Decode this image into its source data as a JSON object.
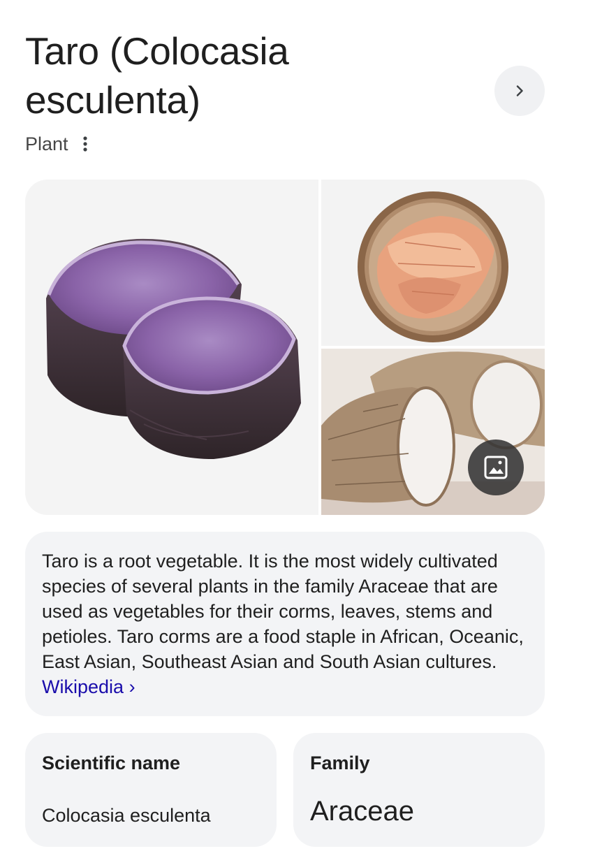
{
  "header": {
    "title": "Taro (Colocasia esculenta)",
    "subtitle": "Plant"
  },
  "icons": {
    "next": "chevron-right-icon",
    "more": "more-vert-icon",
    "images": "image-icon"
  },
  "gallery": {
    "images": [
      {
        "subject": "purple taro halves"
      },
      {
        "subject": "taro chips in bowl"
      },
      {
        "subject": "peeled taro root"
      }
    ]
  },
  "description": {
    "text": "Taro is a root vegetable. It is the most widely cultivated species of several plants in the family Araceae that are used as vegetables for their corms, leaves, stems and petioles. Taro corms are a food staple in African, Oceanic, East Asian, Southeast Asian and South Asian cultures.",
    "source_link": "Wikipedia",
    "source_arrow": "›"
  },
  "facts": [
    {
      "label": "Scientific name",
      "value": "Colocasia esculenta"
    },
    {
      "label": "Family",
      "value": "Araceae"
    }
  ],
  "colors": {
    "link": "#1a0dab",
    "card_bg": "#f3f4f6",
    "text": "#1f1f1f",
    "muted": "#474747"
  }
}
